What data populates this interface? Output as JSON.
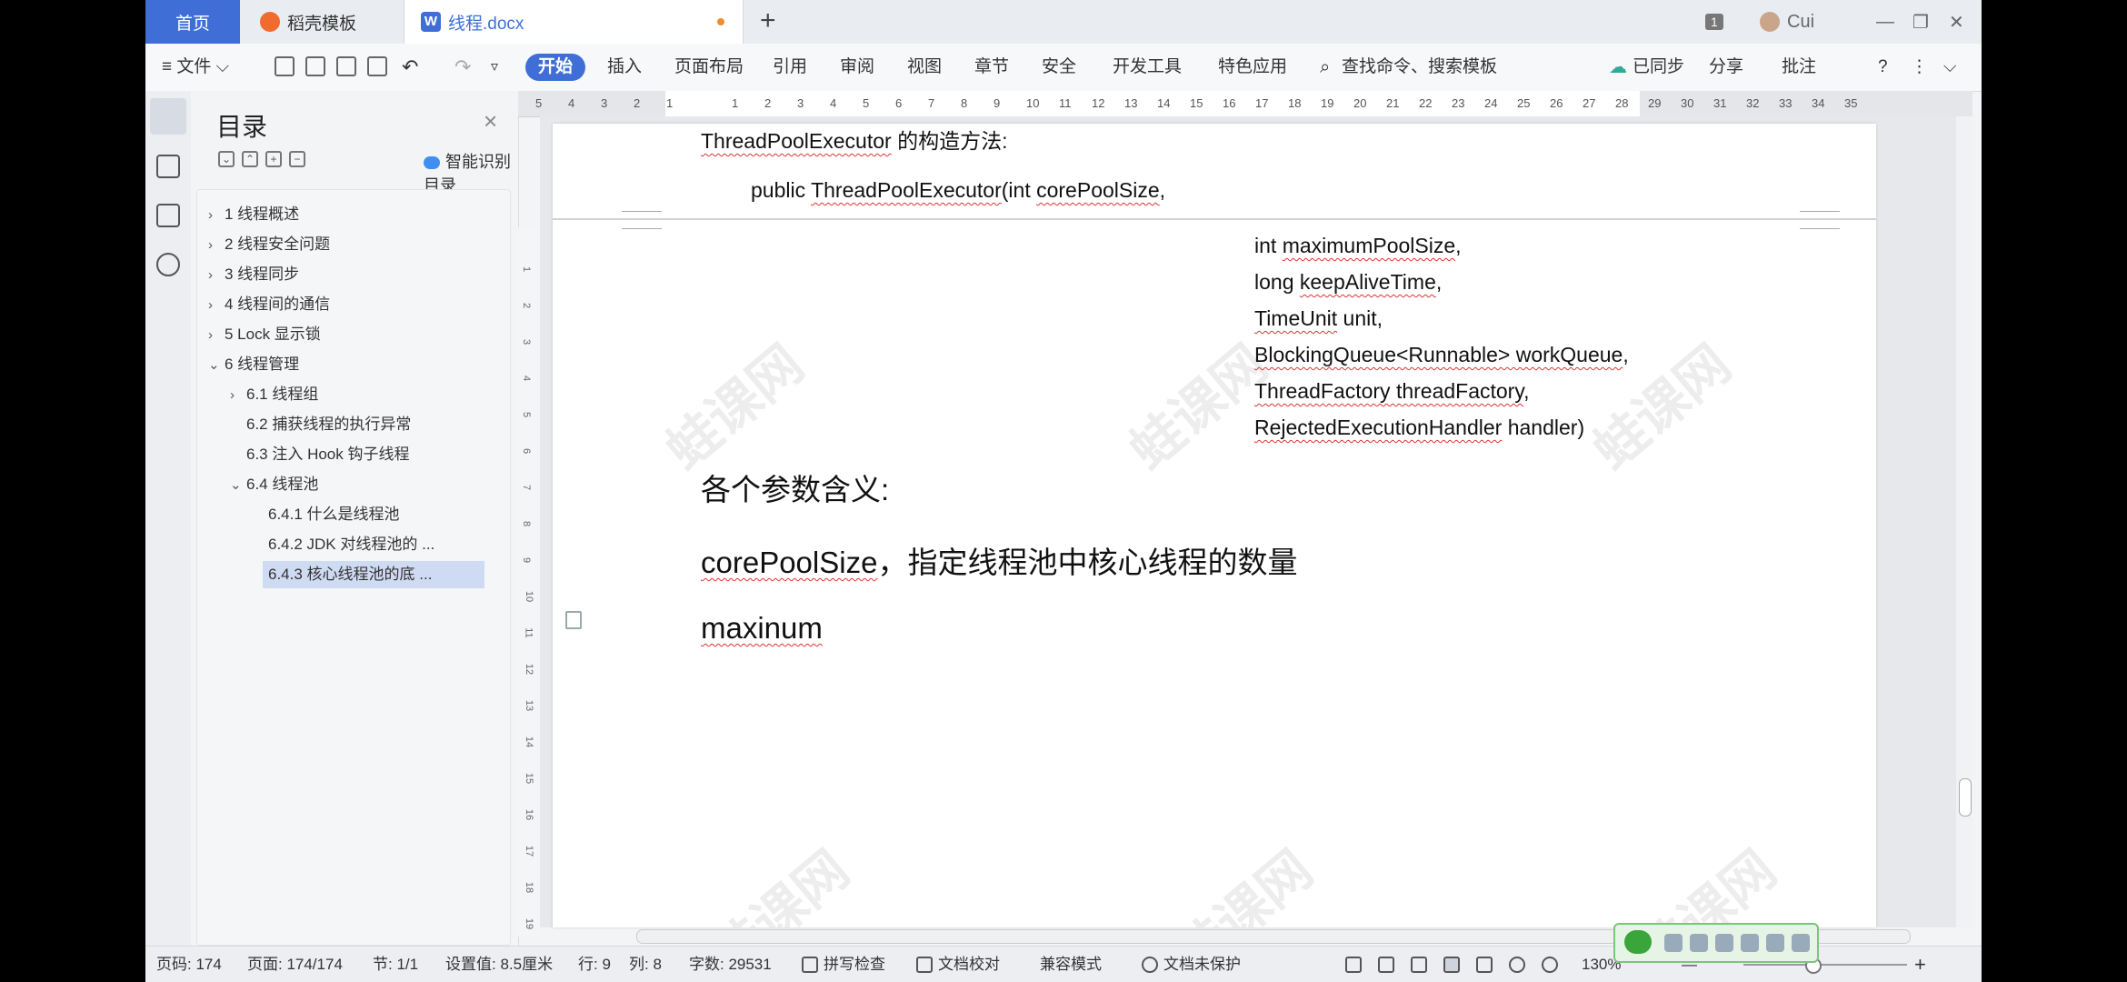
{
  "tabs": {
    "home": "首页",
    "template": "稻壳模板",
    "document": "线程.docx",
    "doc_icon_letter": "W",
    "new_tab": "+",
    "badge": "1",
    "user": "Cui"
  },
  "window": {
    "minimize": "—",
    "restore": "❐",
    "close": "✕"
  },
  "toolbar": {
    "file": "≡ 文件 ⌵",
    "start": "开始",
    "items": [
      "插入",
      "页面布局",
      "引用",
      "审阅",
      "视图",
      "章节",
      "安全",
      "开发工具",
      "特色应用"
    ],
    "search": "查找命令、搜索模板",
    "sync": "已同步",
    "share": "分享",
    "comment": "批注",
    "help": "?"
  },
  "toc": {
    "title": "目录",
    "close": "×",
    "smart": "智能识别目录",
    "items": [
      {
        "label": "1  线程概述",
        "arrow": "›"
      },
      {
        "label": "2  线程安全问题",
        "arrow": "›"
      },
      {
        "label": "3  线程同步",
        "arrow": "›"
      },
      {
        "label": "4 线程间的通信",
        "arrow": "›"
      },
      {
        "label": "5 Lock 显示锁",
        "arrow": "›"
      },
      {
        "label": "6  线程管理",
        "arrow": "⌄"
      },
      {
        "label": "6.1  线程组",
        "arrow": "›"
      },
      {
        "label": "6.2  捕获线程的执行异常",
        "arrow": ""
      },
      {
        "label": "6.3  注入 Hook 钩子线程",
        "arrow": ""
      },
      {
        "label": "6.4 线程池",
        "arrow": "⌄"
      },
      {
        "label": "6.4.1  什么是线程池",
        "arrow": ""
      },
      {
        "label": "6.4.2 JDK 对线程池的 ...",
        "arrow": ""
      },
      {
        "label": "6.4.3  核心线程池的底 ...",
        "arrow": ""
      }
    ]
  },
  "ruler": {
    "top": [
      "5",
      "4",
      "3",
      "2",
      "1",
      "",
      "1",
      "2",
      "3",
      "4",
      "5",
      "6",
      "7",
      "8",
      "9",
      "10",
      "11",
      "12",
      "13",
      "14",
      "15",
      "16",
      "17",
      "18",
      "19",
      "20",
      "21",
      "22",
      "23",
      "24",
      "25",
      "26",
      "27",
      "28",
      "29",
      "30",
      "31",
      "32",
      "33",
      "34",
      "35"
    ],
    "side": [
      "1",
      "2",
      "3",
      "4",
      "5",
      "6",
      "7",
      "8",
      "9",
      "10",
      "11",
      "12",
      "13",
      "14",
      "15",
      "16",
      "17",
      "18",
      "19"
    ]
  },
  "document": {
    "line1_code": "ThreadPoolExecutor",
    "line1_rest": " 的构造方法:",
    "line2_a": "public ",
    "line2_b": "ThreadPoolExecutor",
    "line2_c": "(int ",
    "line2_d": "corePoolSize",
    "line2_e": ",",
    "params": [
      {
        "a": "int ",
        "b": "maximumPoolSize",
        "c": ","
      },
      {
        "a": "long ",
        "b": "keepAliveTime",
        "c": ","
      },
      {
        "a": "",
        "b": "TimeUnit",
        "c": " unit,"
      },
      {
        "a": "",
        "b": "BlockingQueue<Runnable> workQueue",
        "c": ","
      },
      {
        "a": "",
        "b": "ThreadFactory threadFactory",
        "c": ","
      },
      {
        "a": "",
        "b": "RejectedExecutionHandler",
        "c": " handler)"
      }
    ],
    "heading": "各个参数含义:",
    "core_term": "corePoolSize",
    "core_desc": "，指定线程池中核心线程的数量",
    "maxinum": "maxinum",
    "watermark": "蛙课网"
  },
  "status": {
    "page_no": "页码: 174",
    "pages": "页面: 174/174",
    "section": "节: 1/1",
    "setting": "设置值: 8.5厘米",
    "row": "行: 9",
    "col": "列: 8",
    "words": "字数: 29531",
    "spell": "拼写检查",
    "proof": "文档校对",
    "compat": "兼容模式",
    "protect": "文档未保护",
    "zoom": "130%",
    "zoom_minus": "—",
    "zoom_plus": "+"
  }
}
